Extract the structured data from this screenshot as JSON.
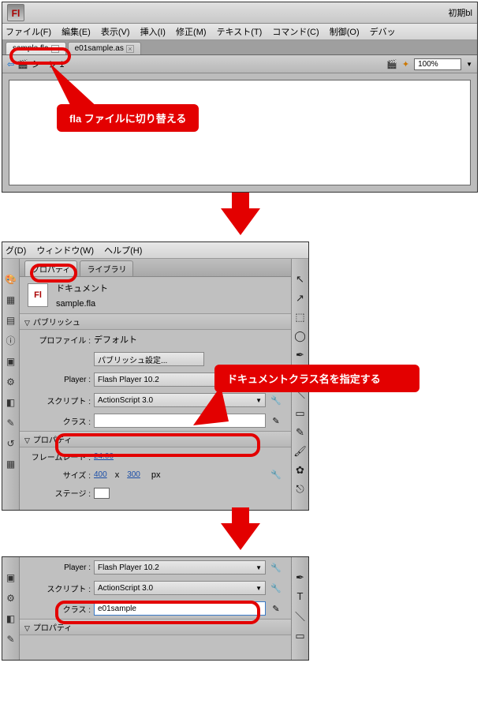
{
  "titlebar_right": "初期bl",
  "menus": [
    "ファイル(F)",
    "編集(E)",
    "表示(V)",
    "挿入(I)",
    "修正(M)",
    "テキスト(T)",
    "コマンド(C)",
    "制御(O)",
    "デバッ"
  ],
  "menus2": [
    "グ(D)",
    "ウィンドウ(W)",
    "ヘルプ(H)"
  ],
  "tabs": [
    {
      "label": "sample.fla"
    },
    {
      "label": "e01sample.as"
    }
  ],
  "scene_label": "シーン 1",
  "zoom": "100%",
  "callout1": "fla ファイルに切り替える",
  "callout2": "ドキュメントクラス名を指定する",
  "props_tabs": [
    "プロパティ",
    "ライブラリ"
  ],
  "doc_type": "ドキュメント",
  "doc_name": "sample.fla",
  "sections": {
    "publish": "パブリッシュ",
    "properties": "プロパティ"
  },
  "labels": {
    "profile": "プロファイル :",
    "profile_val": "デフォルト",
    "publish_settings": "パブリッシュ設定...",
    "player": "Player :",
    "script": "スクリプト :",
    "class": "クラス :",
    "fps": "フレームレート :",
    "size": "サイズ :",
    "stage": "ステージ :"
  },
  "values": {
    "player": "Flash Player 10.2",
    "script": "ActionScript 3.0",
    "class_empty": "",
    "class_filled": "e01sample",
    "fps": "24.00",
    "w": "400",
    "h": "300",
    "dim_sep": "x",
    "px": "px"
  }
}
